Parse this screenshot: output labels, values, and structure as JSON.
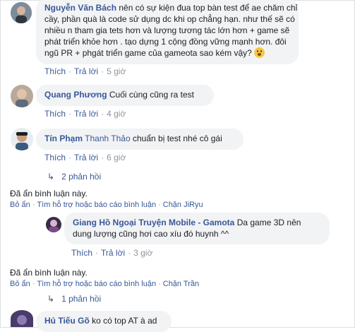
{
  "comments": [
    {
      "name": "Nguyễn Văn Bách",
      "text_lines": [
        "nên có sự kiện đua top bàn test để ae chăm chỉ",
        "cầy, phần quà là code sử dụng dc khi op chẳng hạn. như thế sẽ có",
        "nhiều n tham gia tets hơn và lượng tương tác lớn hơn + game sẽ",
        "phát triển khỏe hơn . tạo dựng 1 cộng đồng vững mạnh hơn. đôi",
        "ngũ PR + phgát triển game của gameota sao kém vậy?"
      ],
      "emoji": "worried-face-emoji",
      "like": "Thích",
      "reply": "Trả lời",
      "time": "5 giờ"
    },
    {
      "name": "Quang Phương",
      "text": "Cuối cùng cũng ra test",
      "like": "Thích",
      "reply": "Trả lời",
      "time": "4 giờ"
    },
    {
      "name": "Tín Phạm",
      "tag": "Thanh Thảo",
      "text": "chuẩn bị test nhé cô gái",
      "like": "Thích",
      "reply": "Trả lời",
      "time": "6 giờ",
      "replies": "2 phản hồi"
    },
    {
      "name": "Giang Hồ Ngoại Truyện Mobile - Gamota",
      "text_first": "Da game 3D nên",
      "text_second": "dung lượng cũng hơi cao xíu đó huynh ^^",
      "like": "Thích",
      "reply": "Trả lời",
      "time": "3 giờ"
    },
    {
      "name": "Hủ Tiếu Gõ",
      "text": "ko có top AT à ad"
    }
  ],
  "hidden_blocks": [
    {
      "note": "Đã ẩn bình luận này.",
      "unhide": "Bỏ ẩn",
      "report": "Tìm hỗ trợ hoặc báo cáo bình luận",
      "block": "Chặn JiRyu"
    },
    {
      "note": "Đã ẩn bình luận này.",
      "unhide": "Bỏ ẩn",
      "report": "Tìm hỗ trợ hoặc báo cáo bình luận",
      "block": "Chặn Trần",
      "replies": "1 phản hồi"
    }
  ],
  "colors": {
    "link": "#385898",
    "bubble": "#f2f3f5",
    "meta": "#90949c"
  }
}
